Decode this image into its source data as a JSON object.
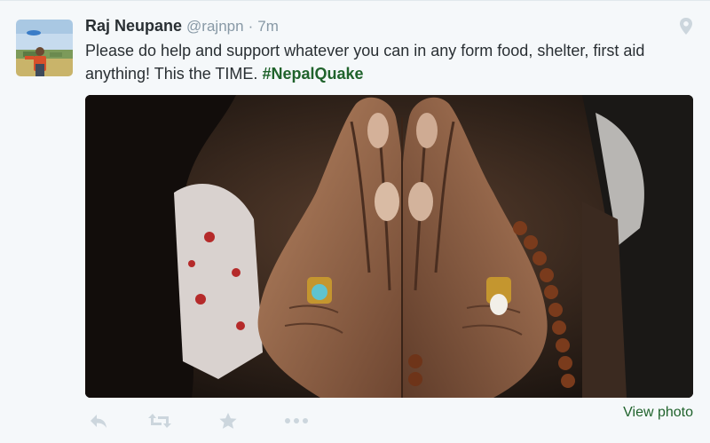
{
  "tweet": {
    "author_name": "Raj Neupane",
    "handle": "@rajnpn",
    "separator": "·",
    "time": "7m",
    "text": "Please do help and support whatever you can in any form food, shelter, first aid anything! This the TIME. ",
    "hashtag": "#NepalQuake",
    "view_photo_label": "View photo"
  },
  "icons": {
    "location": "location-pin-icon",
    "reply": "reply-icon",
    "retweet": "retweet-icon",
    "favorite": "star-icon",
    "more": "more-icon"
  },
  "colors": {
    "background": "#f5f8fa",
    "name": "#292f33",
    "muted": "#8899a6",
    "link": "#20632c",
    "action_icon": "#ccd6dd"
  }
}
